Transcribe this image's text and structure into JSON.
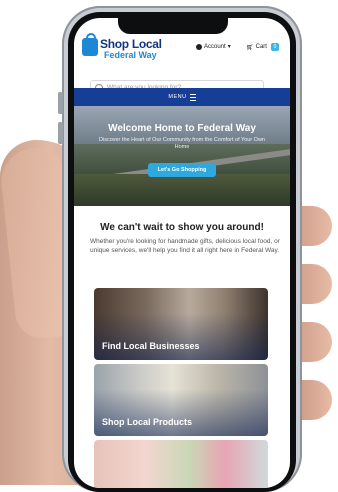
{
  "header": {
    "logo_top": "Shop Local",
    "logo_bottom": "Federal Way",
    "account_label": "Account",
    "cart_label": "Cart",
    "cart_count": "0"
  },
  "search": {
    "placeholder": "What are you looking for?"
  },
  "menu": {
    "label": "MENU"
  },
  "hero": {
    "title": "Welcome Home to Federal Way",
    "subtitle": "Discover the Heart of Our Community from the Comfort of Your Own Home",
    "button_label": "Let's Go Shopping"
  },
  "intro": {
    "title": "We can't wait to show you around!",
    "body": "Whether you're looking for handmade gifts, delicious local food, or unique services, we'll help you find it all right here in Federal Way."
  },
  "cards": [
    {
      "label": "Find Local Businesses"
    },
    {
      "label": "Shop Local Products"
    },
    {
      "label": ""
    }
  ],
  "colors": {
    "brand_navy": "#163e96",
    "brand_blue": "#1d88d6",
    "accent": "#2ea9e0"
  }
}
